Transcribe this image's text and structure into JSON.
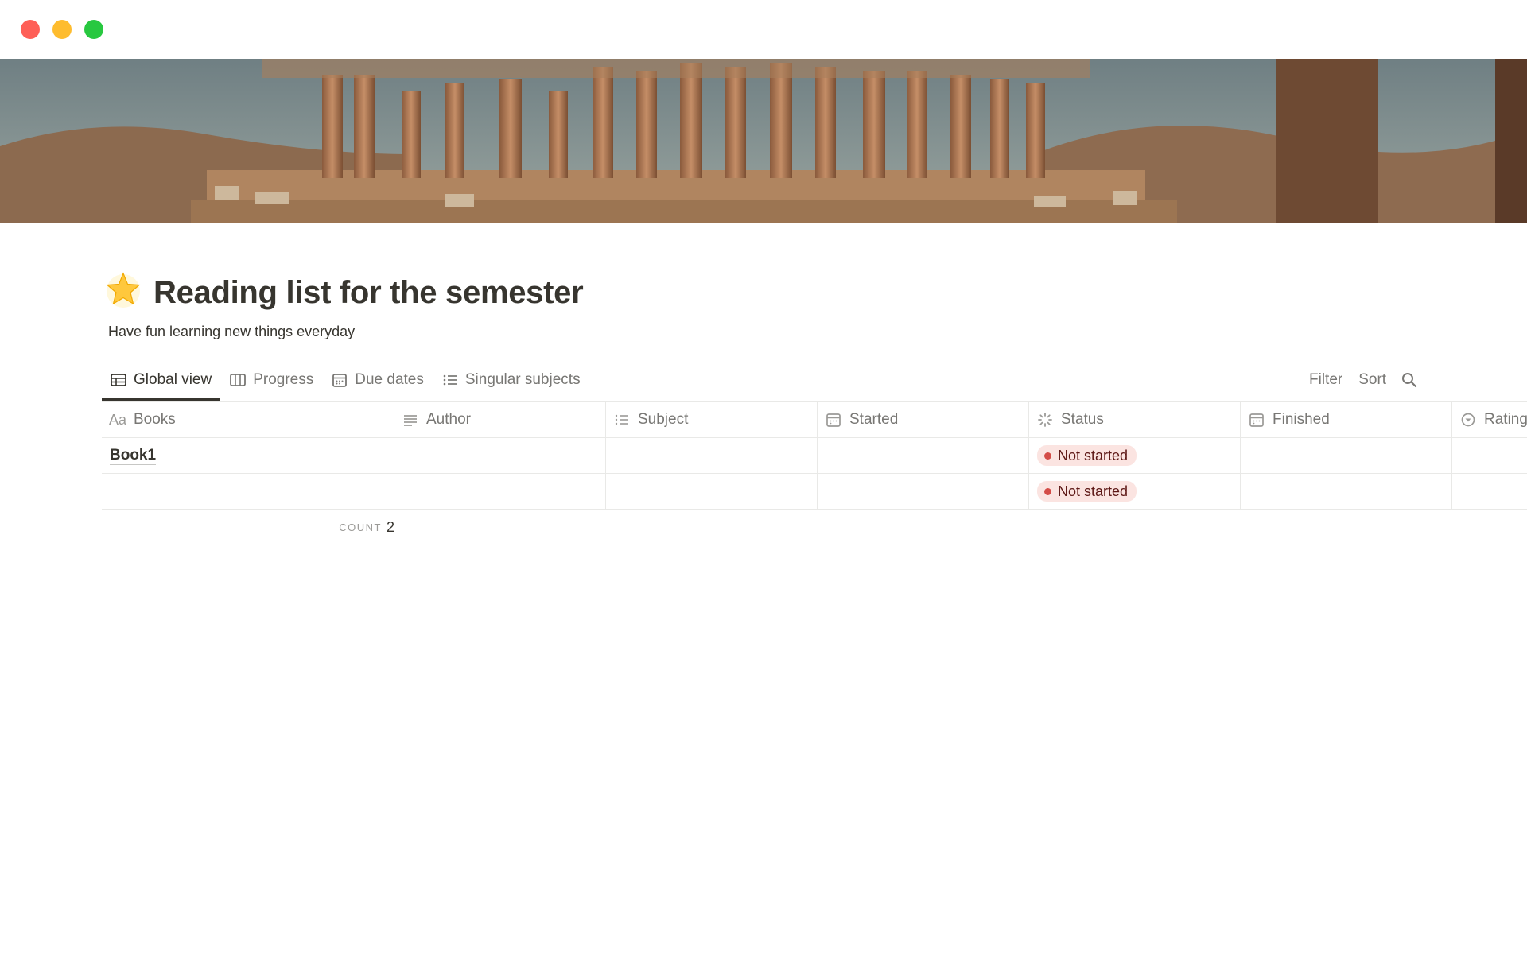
{
  "window": {
    "controls": [
      "close",
      "minimize",
      "zoom"
    ]
  },
  "page": {
    "title": "Reading list for the semester",
    "subtitle": "Have fun learning new things everyday",
    "icon": "glowing-star-icon"
  },
  "tabs": [
    {
      "label": "Global view",
      "icon": "table-icon",
      "active": true
    },
    {
      "label": "Progress",
      "icon": "board-icon",
      "active": false
    },
    {
      "label": "Due dates",
      "icon": "calendar-icon",
      "active": false
    },
    {
      "label": "Singular subjects",
      "icon": "list-icon",
      "active": false
    }
  ],
  "toolbar": {
    "filter": "Filter",
    "sort": "Sort",
    "search_icon": "search-icon"
  },
  "table": {
    "columns": [
      {
        "label": "Books",
        "icon": "Aa"
      },
      {
        "label": "Author",
        "icon": "text-lines-icon"
      },
      {
        "label": "Subject",
        "icon": "multi-select-icon"
      },
      {
        "label": "Started",
        "icon": "calendar-icon"
      },
      {
        "label": "Status",
        "icon": "status-icon"
      },
      {
        "label": "Finished",
        "icon": "calendar-icon"
      },
      {
        "label": "Rating",
        "icon": "select-icon"
      }
    ],
    "rows": [
      {
        "book": "Book1",
        "author": "",
        "subject": "",
        "started": "",
        "status": "Not started",
        "finished": "",
        "rating": ""
      },
      {
        "book": "",
        "author": "",
        "subject": "",
        "started": "",
        "status": "Not started",
        "finished": "",
        "rating": ""
      }
    ],
    "footer": {
      "count_label": "COUNT",
      "count_value": "2"
    }
  },
  "colors": {
    "status_not_started_bg": "#fbe4e1",
    "status_not_started_dot": "#d44c47",
    "text": "#37352f",
    "muted": "#787774"
  }
}
